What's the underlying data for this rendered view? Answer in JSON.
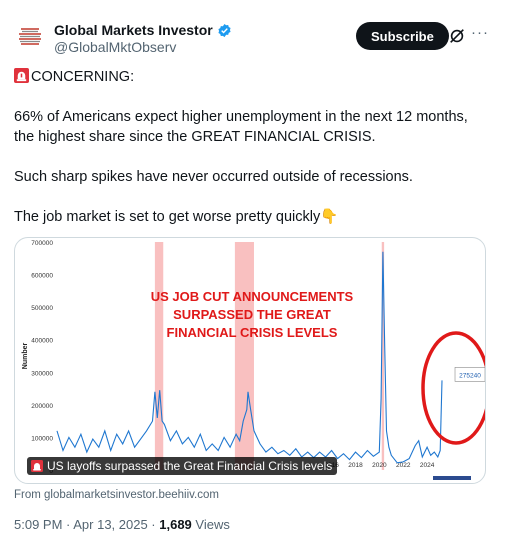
{
  "author": {
    "name": "Global Markets Investor",
    "handle": "@GlobalMktObserv",
    "verified": true
  },
  "actions": {
    "subscribe_label": "Subscribe",
    "more_label": "···"
  },
  "tweet": {
    "line1": "CONCERNING:",
    "line2": "66% of Americans expect higher unemployment in the next 12 months, the highest share since the GREAT FINANCIAL CRISIS.",
    "line3": "Such sharp spikes have never occurred outside of recessions.",
    "line4": "The job market is set to get worse pretty quickly",
    "emoji_end": "👇"
  },
  "media": {
    "caption": "US layoffs surpassed the Great Financial Crisis levels",
    "headline": [
      "US JOB CUT ANNOUNCEMENTS",
      "SURPASSED THE GREAT",
      "FINANCIAL CRISIS LEVELS"
    ],
    "callout": "275240",
    "ylabel": "Number"
  },
  "source": "From globalmarketsinvestor.beehiiv.com",
  "meta": {
    "time": "5:09 PM · Apr 13, 2025 · ",
    "views_count": "1,689",
    "views_label": " Views"
  },
  "colors": {
    "accent": "#1d9bf0",
    "line": "#1f77d0",
    "recession": "#f8b9b9",
    "headline": "#e01919"
  },
  "chart_data": {
    "type": "line",
    "ylabel": "Number",
    "ylim": [
      0,
      700000
    ],
    "yticks": [
      0,
      100000,
      200000,
      300000,
      400000,
      500000,
      600000,
      700000
    ],
    "xticks": [
      "2016",
      "2018",
      "2020",
      "2022",
      "2024"
    ],
    "xlim": [
      1993,
      2025.5
    ],
    "recession_bands": [
      [
        2001.2,
        2001.9
      ],
      [
        2007.9,
        2009.5
      ],
      [
        2020.2,
        2020.4
      ]
    ],
    "series": [
      {
        "values": [
          [
            1993,
            120000
          ],
          [
            1993.5,
            60000
          ],
          [
            1994,
            100000
          ],
          [
            1994.5,
            70000
          ],
          [
            1995,
            110000
          ],
          [
            1995.5,
            55000
          ],
          [
            1996,
            95000
          ],
          [
            1996.5,
            70000
          ],
          [
            1997,
            120000
          ],
          [
            1997.5,
            60000
          ],
          [
            1998,
            110000
          ],
          [
            1998.5,
            80000
          ],
          [
            1999,
            120000
          ],
          [
            1999.5,
            70000
          ],
          [
            2000,
            95000
          ],
          [
            2000.5,
            120000
          ],
          [
            2001,
            150000
          ],
          [
            2001.2,
            240000
          ],
          [
            2001.4,
            160000
          ],
          [
            2001.6,
            245000
          ],
          [
            2001.8,
            150000
          ],
          [
            2002,
            140000
          ],
          [
            2002.5,
            90000
          ],
          [
            2003,
            120000
          ],
          [
            2003.5,
            80000
          ],
          [
            2004,
            100000
          ],
          [
            2004.5,
            70000
          ],
          [
            2005,
            110000
          ],
          [
            2005.5,
            60000
          ],
          [
            2006,
            80000
          ],
          [
            2006.5,
            60000
          ],
          [
            2007,
            100000
          ],
          [
            2007.5,
            70000
          ],
          [
            2008,
            110000
          ],
          [
            2008.3,
            90000
          ],
          [
            2008.6,
            150000
          ],
          [
            2008.9,
            185000
          ],
          [
            2009,
            240000
          ],
          [
            2009.2,
            190000
          ],
          [
            2009.5,
            120000
          ],
          [
            2010,
            80000
          ],
          [
            2010.5,
            55000
          ],
          [
            2011,
            70000
          ],
          [
            2011.5,
            50000
          ],
          [
            2012,
            60000
          ],
          [
            2012.5,
            45000
          ],
          [
            2013,
            65000
          ],
          [
            2013.5,
            40000
          ],
          [
            2014,
            55000
          ],
          [
            2014.5,
            38000
          ],
          [
            2015,
            55000
          ],
          [
            2015.5,
            40000
          ],
          [
            2016,
            60000
          ],
          [
            2016.5,
            35000
          ],
          [
            2017,
            50000
          ],
          [
            2017.5,
            32000
          ],
          [
            2018,
            55000
          ],
          [
            2018.5,
            38000
          ],
          [
            2019,
            60000
          ],
          [
            2019.5,
            42000
          ],
          [
            2020,
            55000
          ],
          [
            2020.15,
            220000
          ],
          [
            2020.3,
            670000
          ],
          [
            2020.45,
            380000
          ],
          [
            2020.6,
            120000
          ],
          [
            2020.8,
            70000
          ],
          [
            2021,
            45000
          ],
          [
            2021.5,
            22000
          ],
          [
            2022,
            25000
          ],
          [
            2022.5,
            35000
          ],
          [
            2023,
            75000
          ],
          [
            2023.3,
            90000
          ],
          [
            2023.6,
            40000
          ],
          [
            2024,
            70000
          ],
          [
            2024.3,
            45000
          ],
          [
            2024.6,
            55000
          ],
          [
            2024.9,
            40000
          ],
          [
            2025.1,
            60000
          ],
          [
            2025.25,
            275240
          ]
        ]
      }
    ]
  }
}
